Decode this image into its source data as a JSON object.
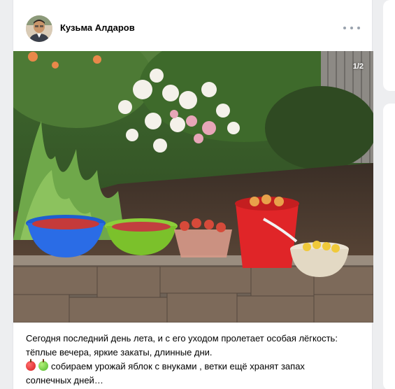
{
  "post": {
    "author": "Кузьма Алдаров",
    "photo_counter": "1/2",
    "text": {
      "line1": "Сегодня последний день лета, и с его уходом пролетает особая лёгкость:",
      "line2": "тёплые вечера, яркие закаты, длинные дни.",
      "line3": "собираем урожай яблок с внуками , ветки ещё хранят запах",
      "line4": "солнечных дней…"
    },
    "emojis": [
      "red-apple-icon",
      "green-apple-icon"
    ]
  },
  "colors": {
    "page_background": "#edeef0",
    "card_background": "#ffffff",
    "author_text": "#000000",
    "more_dots": "#99a2ad"
  }
}
